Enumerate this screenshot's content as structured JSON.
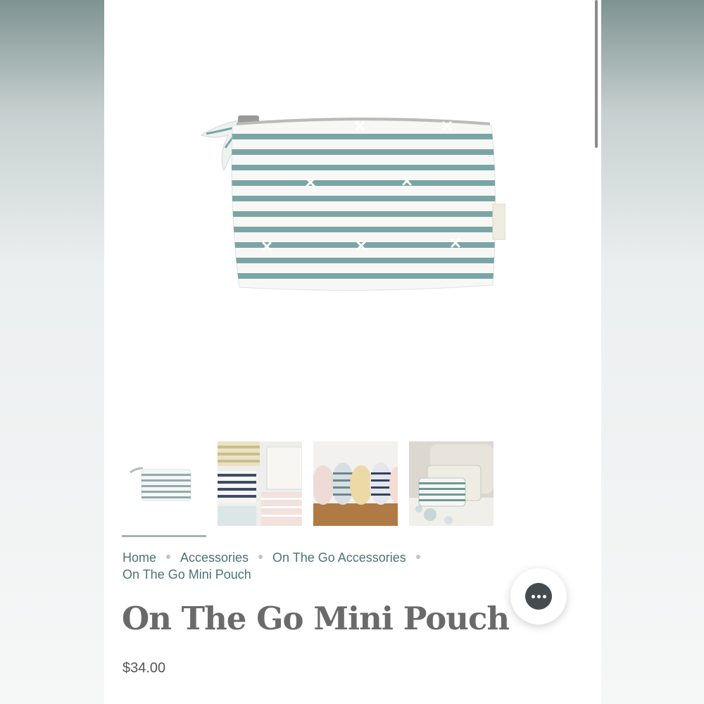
{
  "breadcrumb": {
    "home": "Home",
    "accessories": "Accessories",
    "on_the_go": "On The Go Accessories",
    "current": "On The Go Mini Pouch"
  },
  "product": {
    "title": "On The Go Mini Pouch",
    "price": "$34.00"
  },
  "icons": {
    "chat": "chat-bubble-icon"
  },
  "colors": {
    "stripe": "#7aa5a6",
    "link": "#4d7278",
    "title": "#6a6a6a"
  }
}
